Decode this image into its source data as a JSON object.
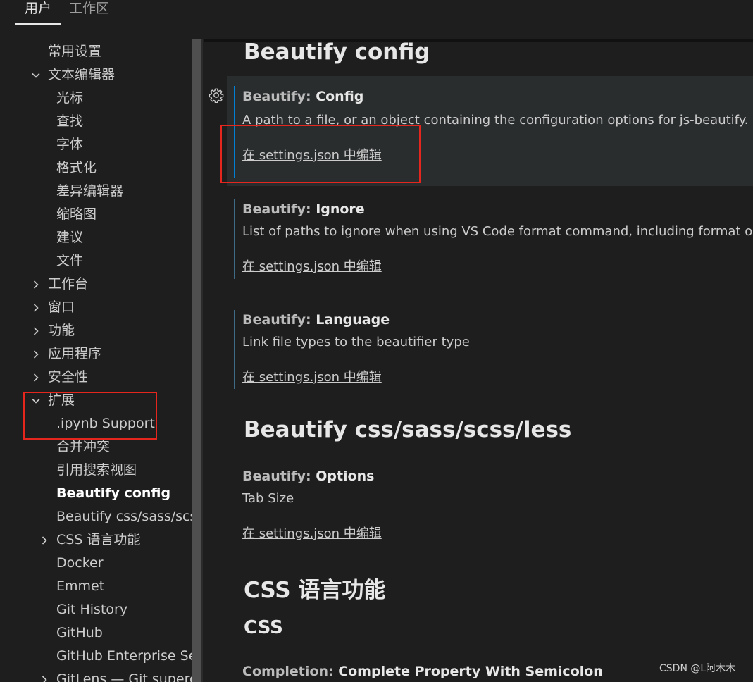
{
  "tabs": [
    {
      "label": "用户",
      "active": true
    },
    {
      "label": "工作区",
      "active": false
    }
  ],
  "toc": {
    "items": [
      {
        "label": "常用设置"
      },
      {
        "label": "文本编辑器",
        "chevron": "down"
      },
      {
        "label": "光标"
      },
      {
        "label": "查找"
      },
      {
        "label": "字体"
      },
      {
        "label": "格式化"
      },
      {
        "label": "差异编辑器"
      },
      {
        "label": "缩略图"
      },
      {
        "label": "建议"
      },
      {
        "label": "文件"
      },
      {
        "label": "工作台",
        "chevron": "right"
      },
      {
        "label": "窗口",
        "chevron": "right"
      },
      {
        "label": "功能",
        "chevron": "right"
      },
      {
        "label": "应用程序",
        "chevron": "right"
      },
      {
        "label": "安全性",
        "chevron": "right"
      },
      {
        "label": "扩展",
        "chevron": "down"
      },
      {
        "label": ".ipynb Support"
      },
      {
        "label": "合并冲突"
      },
      {
        "label": "引用搜索视图"
      },
      {
        "label": "Beautify config",
        "bold": true
      },
      {
        "label": "Beautify css/sass/scss/..."
      },
      {
        "label": "CSS 语言功能",
        "chevron": "right"
      },
      {
        "label": "Docker"
      },
      {
        "label": "Emmet"
      },
      {
        "label": "Git History"
      },
      {
        "label": "GitHub"
      },
      {
        "label": "GitHub Enterprise Ser..."
      },
      {
        "label": "GitLens — Git superch...",
        "chevron": "right"
      }
    ]
  },
  "main": {
    "section1_title": "Beautify config",
    "settings": [
      {
        "category": "Beautify: ",
        "key": "Config",
        "description": "A path to a file, or an object containing the configuration options for js-beautify. If th",
        "link": "在 settings.json 中编辑"
      },
      {
        "category": "Beautify: ",
        "key": "Ignore",
        "description": "List of paths to ignore when using VS Code format command, including format on sa",
        "link": "在 settings.json 中编辑"
      },
      {
        "category": "Beautify: ",
        "key": "Language",
        "description": "Link file types to the beautifier type",
        "link": "在 settings.json 中编辑"
      }
    ],
    "section2_title": "Beautify css/sass/scss/less",
    "options_setting": {
      "category": "Beautify: ",
      "key": "Options",
      "description": "Tab Size",
      "link": "在 settings.json 中编辑"
    },
    "section3_title": "CSS 语言功能",
    "section4_title": "CSS",
    "completion_setting": {
      "category": "Completion: ",
      "key": "Complete Property With Semicolon"
    }
  },
  "watermark": "CSDN @L阿木木",
  "colors": {
    "background": "#1e1e1e",
    "accent_bar": "#007fd4",
    "highlight_box": "#e5261f",
    "focused_row": "#2a2d2e"
  },
  "icons": {
    "gear": "gear-icon",
    "chevron_down": "chevron-down-icon",
    "chevron_right": "chevron-right-icon"
  }
}
